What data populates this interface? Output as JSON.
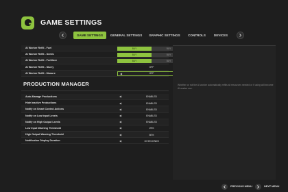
{
  "header": {
    "title": "GAME SETTINGS"
  },
  "tabs": [
    {
      "label": "GAME SETTINGS",
      "active": true
    },
    {
      "label": "GENERAL SETTINGS",
      "active": false
    },
    {
      "label": "GRAPHIC SETTINGS",
      "active": false
    },
    {
      "label": "CONTROLS",
      "active": false
    },
    {
      "label": "DEVICES",
      "active": false
    }
  ],
  "ai_worker_rows": [
    {
      "label": "AI Worker Refill - Fuel",
      "type": "toggle",
      "on": "BUY",
      "off": "BUY",
      "selected": "on"
    },
    {
      "label": "AI Worker Refill - Seeds",
      "type": "toggle",
      "on": "BUY",
      "off": "BUY",
      "selected": "on"
    },
    {
      "label": "AI Worker Refill - Fertilizer",
      "type": "toggle",
      "on": "BUY",
      "off": "BUY",
      "selected": "on"
    },
    {
      "label": "AI Worker Refill - Slurry",
      "type": "select",
      "value": "OFF"
    },
    {
      "label": "AI Worker Refill - Manure",
      "type": "select",
      "value": "OFF",
      "focused": true
    }
  ],
  "production_section_title": "PRODUCTION MANAGER",
  "production_rows": [
    {
      "label": "Auto-Manage Productions",
      "value": "ENABLED"
    },
    {
      "label": "Hide Inactive Productions",
      "value": "ENABLED"
    },
    {
      "label": "Notify on Smart Control Actions",
      "value": "ENABLED"
    },
    {
      "label": "Notify on Low Input Levels",
      "value": "ENABLED"
    },
    {
      "label": "Notify on High Output Levels",
      "value": "ENABLED"
    },
    {
      "label": "Low Input Warning Threshold",
      "value": "25%"
    },
    {
      "label": "High Output Warning Threshold",
      "value": "80%"
    },
    {
      "label": "Notification Display Duration",
      "value": "10 SECONDS"
    }
  ],
  "description": "Whether or not the AI worker automatically refills all resources needed or if using will become AI worker use.",
  "footer": {
    "prev_label": "PREVIOUS MENU",
    "next_label": "NEXT MENU"
  },
  "colors": {
    "accent": "#8ec33f",
    "background": "#1e1e1e"
  },
  "icons": [
    "game-logo-icon",
    "chevron-left-icon",
    "chevron-right-icon",
    "arrow-left-icon",
    "arrow-right-icon"
  ]
}
